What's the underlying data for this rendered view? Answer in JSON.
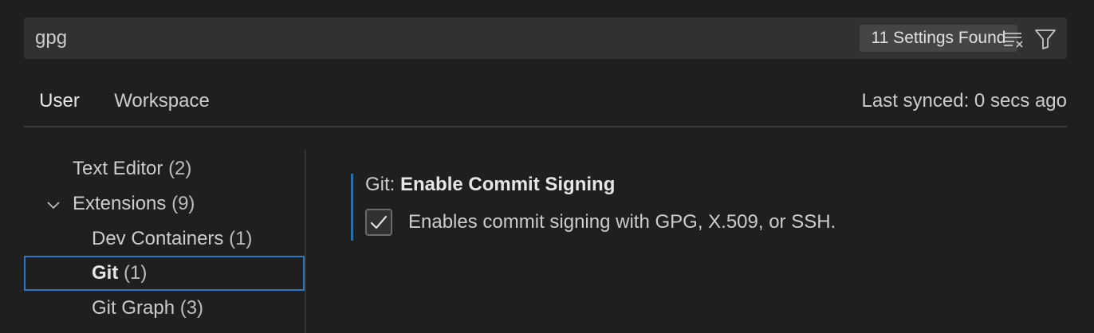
{
  "search": {
    "value": "gpg",
    "results_count": "11 Settings Found",
    "clear_icon": "clear-filter-icon",
    "filter_icon": "filter-icon"
  },
  "tabs": [
    {
      "label": "User",
      "active": true
    },
    {
      "label": "Workspace",
      "active": false
    }
  ],
  "sync_status": "Last synced: 0 secs ago",
  "toc": {
    "text_editor": {
      "label": "Text Editor",
      "count": "(2)"
    },
    "extensions": {
      "label": "Extensions",
      "count": "(9)",
      "expanded": true
    },
    "dev_containers": {
      "label": "Dev Containers",
      "count": "(1)"
    },
    "git": {
      "label": "Git",
      "count": "(1)",
      "selected": true
    },
    "git_graph": {
      "label": "Git Graph",
      "count": "(3)"
    }
  },
  "setting": {
    "category": "Git: ",
    "name": "Enable Commit Signing",
    "checked": true,
    "description": "Enables commit signing with GPG, X.509, or SSH."
  },
  "colors": {
    "background": "#1f1f1f",
    "input_background": "#313131",
    "focus_border": "#2b78c5",
    "modified_indicator": "#2b6ea6"
  }
}
